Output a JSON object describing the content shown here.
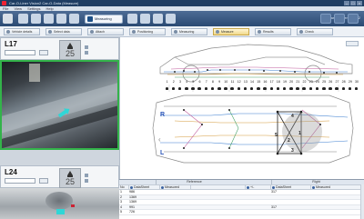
{
  "window": {
    "title": "Car-O-Liner Vision2 Car-O-Data (Measure)",
    "controls": [
      "–",
      "□",
      "×"
    ]
  },
  "menubar": {
    "items": [
      "File",
      "View",
      "Settings",
      "Help"
    ]
  },
  "ribbon": {
    "active_tab_label": "Measuring",
    "right_text": "Car-O-Liner Vision2"
  },
  "steps": {
    "items": [
      "Vehicle details",
      "Select data",
      "Attach",
      "Positioning",
      "Measuring",
      "Results",
      "Check"
    ],
    "highlight_label": "Measure"
  },
  "photos": [
    {
      "id": "L17",
      "count": "25"
    },
    {
      "id": "L24",
      "count": "25"
    }
  ],
  "diagram": {
    "point_numbers": [
      "1",
      "2",
      "3",
      "4",
      "5",
      "6",
      "7",
      "8",
      "9",
      "10",
      "11",
      "12",
      "13",
      "14",
      "15",
      "16",
      "17",
      "18",
      "19",
      "20",
      "21",
      "22",
      "23",
      "24",
      "25",
      "26",
      "27",
      "28",
      "29",
      "30"
    ],
    "side_right": "R",
    "side_left": "L",
    "cross_labels": [
      "1",
      "2",
      "3",
      "4",
      "5"
    ]
  },
  "table": {
    "groups": {
      "left": "Reference",
      "right": "Right"
    },
    "headers": {
      "no": "No",
      "datasheet": "DataSheet",
      "measured": "Measured",
      "diff": "+/-",
      "datasheet_r": "DataSheet",
      "measured_r": "Measured"
    },
    "rows": [
      {
        "no": "1",
        "datasheet": "986",
        "datasheet_r": "317"
      },
      {
        "no": "2",
        "datasheet": "1369",
        "datasheet_r": ""
      },
      {
        "no": "3",
        "datasheet": "1369",
        "datasheet_r": ""
      },
      {
        "no": "4",
        "datasheet": "991",
        "datasheet_r": "317"
      },
      {
        "no": "5",
        "datasheet": "726",
        "datasheet_r": ""
      }
    ]
  },
  "colors": {
    "accent_blue": "#2a55b8",
    "selection_green": "#33b34a",
    "marker_cyan": "#2fd6d6"
  }
}
